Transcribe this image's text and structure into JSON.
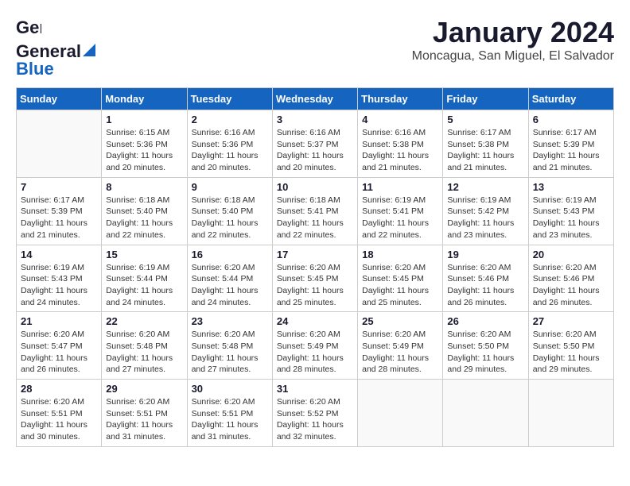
{
  "header": {
    "logo_line1": "General",
    "logo_line2": "Blue",
    "month": "January 2024",
    "location": "Moncagua, San Miguel, El Salvador"
  },
  "days_of_week": [
    "Sunday",
    "Monday",
    "Tuesday",
    "Wednesday",
    "Thursday",
    "Friday",
    "Saturday"
  ],
  "weeks": [
    [
      {
        "day": "",
        "content": ""
      },
      {
        "day": "1",
        "content": "Sunrise: 6:15 AM\nSunset: 5:36 PM\nDaylight: 11 hours\nand 20 minutes."
      },
      {
        "day": "2",
        "content": "Sunrise: 6:16 AM\nSunset: 5:36 PM\nDaylight: 11 hours\nand 20 minutes."
      },
      {
        "day": "3",
        "content": "Sunrise: 6:16 AM\nSunset: 5:37 PM\nDaylight: 11 hours\nand 20 minutes."
      },
      {
        "day": "4",
        "content": "Sunrise: 6:16 AM\nSunset: 5:38 PM\nDaylight: 11 hours\nand 21 minutes."
      },
      {
        "day": "5",
        "content": "Sunrise: 6:17 AM\nSunset: 5:38 PM\nDaylight: 11 hours\nand 21 minutes."
      },
      {
        "day": "6",
        "content": "Sunrise: 6:17 AM\nSunset: 5:39 PM\nDaylight: 11 hours\nand 21 minutes."
      }
    ],
    [
      {
        "day": "7",
        "content": "Sunrise: 6:17 AM\nSunset: 5:39 PM\nDaylight: 11 hours\nand 21 minutes."
      },
      {
        "day": "8",
        "content": "Sunrise: 6:18 AM\nSunset: 5:40 PM\nDaylight: 11 hours\nand 22 minutes."
      },
      {
        "day": "9",
        "content": "Sunrise: 6:18 AM\nSunset: 5:40 PM\nDaylight: 11 hours\nand 22 minutes."
      },
      {
        "day": "10",
        "content": "Sunrise: 6:18 AM\nSunset: 5:41 PM\nDaylight: 11 hours\nand 22 minutes."
      },
      {
        "day": "11",
        "content": "Sunrise: 6:19 AM\nSunset: 5:41 PM\nDaylight: 11 hours\nand 22 minutes."
      },
      {
        "day": "12",
        "content": "Sunrise: 6:19 AM\nSunset: 5:42 PM\nDaylight: 11 hours\nand 23 minutes."
      },
      {
        "day": "13",
        "content": "Sunrise: 6:19 AM\nSunset: 5:43 PM\nDaylight: 11 hours\nand 23 minutes."
      }
    ],
    [
      {
        "day": "14",
        "content": "Sunrise: 6:19 AM\nSunset: 5:43 PM\nDaylight: 11 hours\nand 24 minutes."
      },
      {
        "day": "15",
        "content": "Sunrise: 6:19 AM\nSunset: 5:44 PM\nDaylight: 11 hours\nand 24 minutes."
      },
      {
        "day": "16",
        "content": "Sunrise: 6:20 AM\nSunset: 5:44 PM\nDaylight: 11 hours\nand 24 minutes."
      },
      {
        "day": "17",
        "content": "Sunrise: 6:20 AM\nSunset: 5:45 PM\nDaylight: 11 hours\nand 25 minutes."
      },
      {
        "day": "18",
        "content": "Sunrise: 6:20 AM\nSunset: 5:45 PM\nDaylight: 11 hours\nand 25 minutes."
      },
      {
        "day": "19",
        "content": "Sunrise: 6:20 AM\nSunset: 5:46 PM\nDaylight: 11 hours\nand 26 minutes."
      },
      {
        "day": "20",
        "content": "Sunrise: 6:20 AM\nSunset: 5:46 PM\nDaylight: 11 hours\nand 26 minutes."
      }
    ],
    [
      {
        "day": "21",
        "content": "Sunrise: 6:20 AM\nSunset: 5:47 PM\nDaylight: 11 hours\nand 26 minutes."
      },
      {
        "day": "22",
        "content": "Sunrise: 6:20 AM\nSunset: 5:48 PM\nDaylight: 11 hours\nand 27 minutes."
      },
      {
        "day": "23",
        "content": "Sunrise: 6:20 AM\nSunset: 5:48 PM\nDaylight: 11 hours\nand 27 minutes."
      },
      {
        "day": "24",
        "content": "Sunrise: 6:20 AM\nSunset: 5:49 PM\nDaylight: 11 hours\nand 28 minutes."
      },
      {
        "day": "25",
        "content": "Sunrise: 6:20 AM\nSunset: 5:49 PM\nDaylight: 11 hours\nand 28 minutes."
      },
      {
        "day": "26",
        "content": "Sunrise: 6:20 AM\nSunset: 5:50 PM\nDaylight: 11 hours\nand 29 minutes."
      },
      {
        "day": "27",
        "content": "Sunrise: 6:20 AM\nSunset: 5:50 PM\nDaylight: 11 hours\nand 29 minutes."
      }
    ],
    [
      {
        "day": "28",
        "content": "Sunrise: 6:20 AM\nSunset: 5:51 PM\nDaylight: 11 hours\nand 30 minutes."
      },
      {
        "day": "29",
        "content": "Sunrise: 6:20 AM\nSunset: 5:51 PM\nDaylight: 11 hours\nand 31 minutes."
      },
      {
        "day": "30",
        "content": "Sunrise: 6:20 AM\nSunset: 5:51 PM\nDaylight: 11 hours\nand 31 minutes."
      },
      {
        "day": "31",
        "content": "Sunrise: 6:20 AM\nSunset: 5:52 PM\nDaylight: 11 hours\nand 32 minutes."
      },
      {
        "day": "",
        "content": ""
      },
      {
        "day": "",
        "content": ""
      },
      {
        "day": "",
        "content": ""
      }
    ]
  ]
}
